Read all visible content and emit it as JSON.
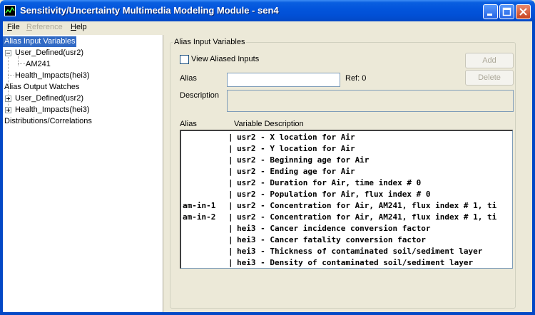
{
  "window": {
    "title": "Sensitivity/Uncertainty Multimedia Modeling Module - sen4"
  },
  "menu": {
    "items": [
      {
        "label": "File",
        "accel": "F",
        "rest": "ile",
        "enabled": true
      },
      {
        "label": "Reference",
        "accel": "R",
        "rest": "eference",
        "enabled": false
      },
      {
        "label": "Help",
        "accel": "H",
        "rest": "elp",
        "enabled": true
      }
    ]
  },
  "tree": {
    "nodes": [
      {
        "label": "Alias Input Variables",
        "selected": true
      },
      {
        "label": "User_Defined(usr2)",
        "expander": "minus"
      },
      {
        "label": "AM241"
      },
      {
        "label": "Health_Impacts(hei3)"
      },
      {
        "label": "Alias Output Watches"
      },
      {
        "label": "User_Defined(usr2)",
        "expander": "plus"
      },
      {
        "label": "Health_Impacts(hei3)",
        "expander": "plus"
      },
      {
        "label": "Distributions/Correlations"
      }
    ]
  },
  "panel": {
    "group_title": "Alias Input Variables",
    "view_aliased_label": "View Aliased Inputs",
    "view_aliased_checked": false,
    "alias_label": "Alias",
    "alias_value": "",
    "ref_label": "Ref: 0",
    "description_label": "Description",
    "description_value": "",
    "add_label": "Add",
    "delete_label": "Delete",
    "col_alias": "Alias",
    "col_description": "Variable Description"
  },
  "variables": [
    {
      "alias": "",
      "desc": "usr2 - X location for Air"
    },
    {
      "alias": "",
      "desc": "usr2 - Y location for Air"
    },
    {
      "alias": "",
      "desc": "usr2 - Beginning age for Air"
    },
    {
      "alias": "",
      "desc": "usr2 - Ending age for Air"
    },
    {
      "alias": "",
      "desc": "usr2 - Duration for Air, time index # 0"
    },
    {
      "alias": "",
      "desc": "usr2 - Population for Air, flux index # 0"
    },
    {
      "alias": "am-in-1",
      "desc": "usr2 - Concentration for Air, AM241, flux index # 1, ti"
    },
    {
      "alias": "am-in-2",
      "desc": "usr2 - Concentration for Air, AM241, flux index # 1, ti"
    },
    {
      "alias": "",
      "desc": "hei3 - Cancer incidence conversion factor"
    },
    {
      "alias": "",
      "desc": "hei3 - Cancer fatality conversion factor"
    },
    {
      "alias": "",
      "desc": "hei3 - Thickness of contaminated soil/sediment layer"
    },
    {
      "alias": "",
      "desc": "hei3 - Density of contaminated soil/sediment layer"
    }
  ]
}
